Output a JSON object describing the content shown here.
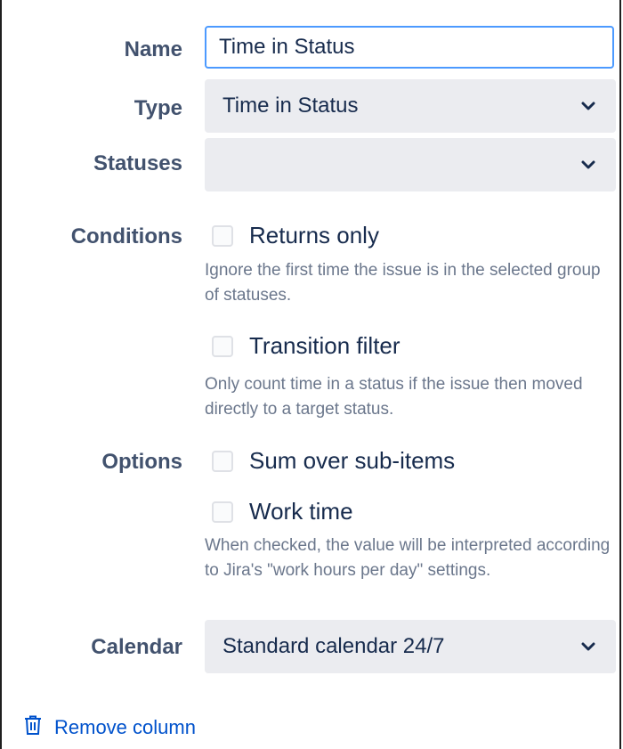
{
  "form": {
    "name_label": "Name",
    "name_value": "Time in Status",
    "type_label": "Type",
    "type_value": "Time in Status",
    "statuses_label": "Statuses",
    "statuses_value": "",
    "conditions_label": "Conditions",
    "returns_only_label": "Returns only",
    "returns_only_checked": false,
    "returns_only_help": "Ignore the first time the issue is in the selected group of statuses.",
    "transition_filter_label": "Transition filter",
    "transition_filter_checked": false,
    "transition_filter_help": "Only count time in a status if the issue then moved directly to a target status.",
    "options_label": "Options",
    "sum_over_label": "Sum over sub-items",
    "sum_over_checked": false,
    "work_time_label": "Work time",
    "work_time_checked": false,
    "work_time_help": "When checked, the value will be interpreted according to Jira's \"work hours per day\" settings.",
    "calendar_label": "Calendar",
    "calendar_value": "Standard calendar 24/7"
  },
  "footer": {
    "remove_label": "Remove column"
  },
  "icons": {
    "chevron": "chevron-down-icon",
    "trash": "trash-icon"
  },
  "colors": {
    "label": "#42526e",
    "text": "#172b4d",
    "help": "#6b778c",
    "focus_border": "#4c9aff",
    "select_bg": "#ebecf0",
    "link": "#0052cc"
  }
}
